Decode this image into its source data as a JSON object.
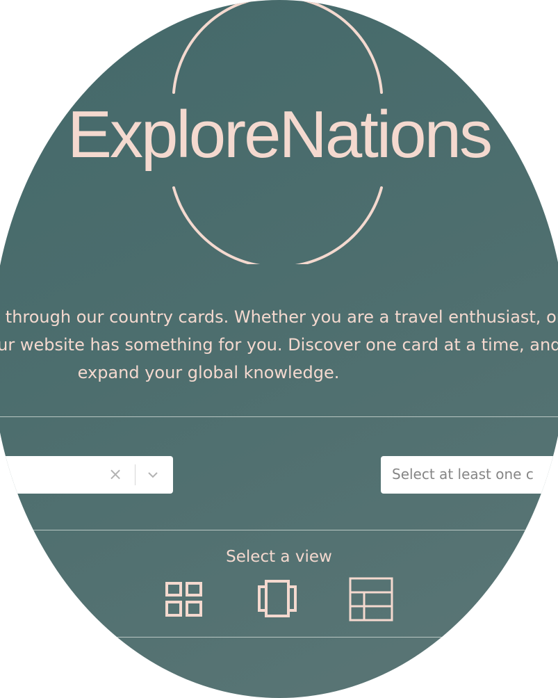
{
  "brand": {
    "logo_text": "ExploreNations"
  },
  "intro": {
    "text": "Explore the world through our country cards. Whether you are a travel enthusiast, or simply curious, our website has something for you. Discover one card at a time, and expand your global knowledge."
  },
  "filters": {
    "left_select": {
      "value": "",
      "clear_icon": "×"
    },
    "right_select": {
      "placeholder": "Select at least one c"
    }
  },
  "views": {
    "label": "Select a view",
    "options": [
      {
        "icon": "grid-view-icon"
      },
      {
        "icon": "carousel-view-icon"
      },
      {
        "icon": "table-view-icon"
      }
    ]
  },
  "colors": {
    "accent": "#f4d9cf",
    "background_top": "#44696a",
    "background_bottom": "#5b7676"
  }
}
